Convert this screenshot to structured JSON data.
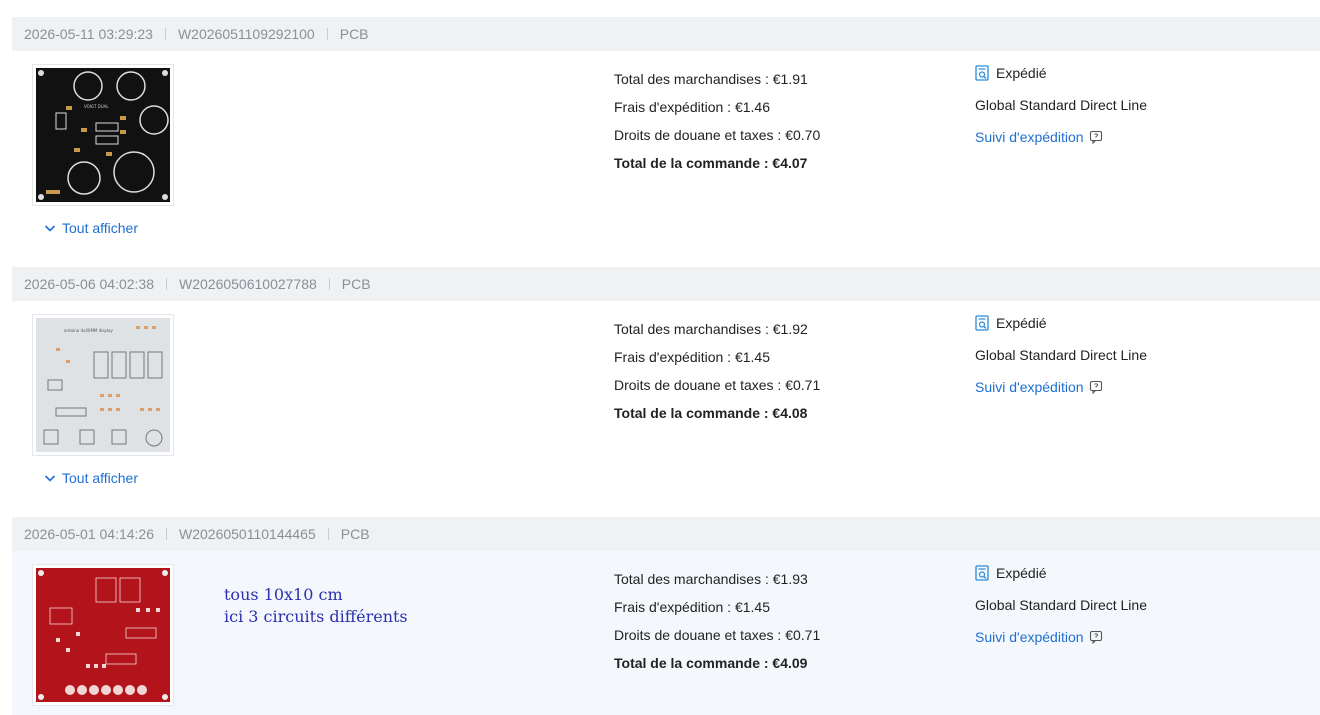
{
  "orders": [
    {
      "date": "2026-05-11 03:29:23",
      "order_no": "W2026051109292100",
      "category": "PCB",
      "show_all": "Tout afficher",
      "merch_total": "Total des marchandises : €1.91",
      "shipping": "Frais d'expédition : €1.46",
      "customs": "Droits de douane et taxes : €0.70",
      "order_total": "Total de la commande : €4.07",
      "status": "Expédié",
      "carrier": "Global Standard Direct Line",
      "tracking": "Suivi d'expédition"
    },
    {
      "date": "2026-05-06 04:02:38",
      "order_no": "W2026050610027788",
      "category": "PCB",
      "show_all": "Tout afficher",
      "merch_total": "Total des marchandises : €1.92",
      "shipping": "Frais d'expédition : €1.45",
      "customs": "Droits de douane et taxes : €0.71",
      "order_total": "Total de la commande : €4.08",
      "status": "Expédié",
      "carrier": "Global Standard Direct Line",
      "tracking": "Suivi d'expédition"
    },
    {
      "date": "2026-05-01 04:14:26",
      "order_no": "W2026050110144465",
      "category": "PCB",
      "merch_total": "Total des marchandises : €1.93",
      "shipping": "Frais d'expédition : €1.45",
      "customs": "Droits de douane et taxes : €0.71",
      "order_total": "Total de la commande : €4.09",
      "status": "Expédié",
      "carrier": "Global Standard Direct Line",
      "tracking": "Suivi d'expédition",
      "note_line1": "tous 10x10 cm",
      "note_line2": "ici 3 circuits différents"
    }
  ],
  "colors": {
    "header_bg": "#f0f1f3",
    "link": "#1f6fd1",
    "note": "#2b2fb0",
    "pcb_black": "#111111",
    "pcb_white": "#dfe2e5",
    "pcb_red": "#b3141b"
  },
  "icons": {
    "status": "shipped-search-icon",
    "tracking": "tracking-popup-icon",
    "show_all": "chevron-down-icon"
  }
}
